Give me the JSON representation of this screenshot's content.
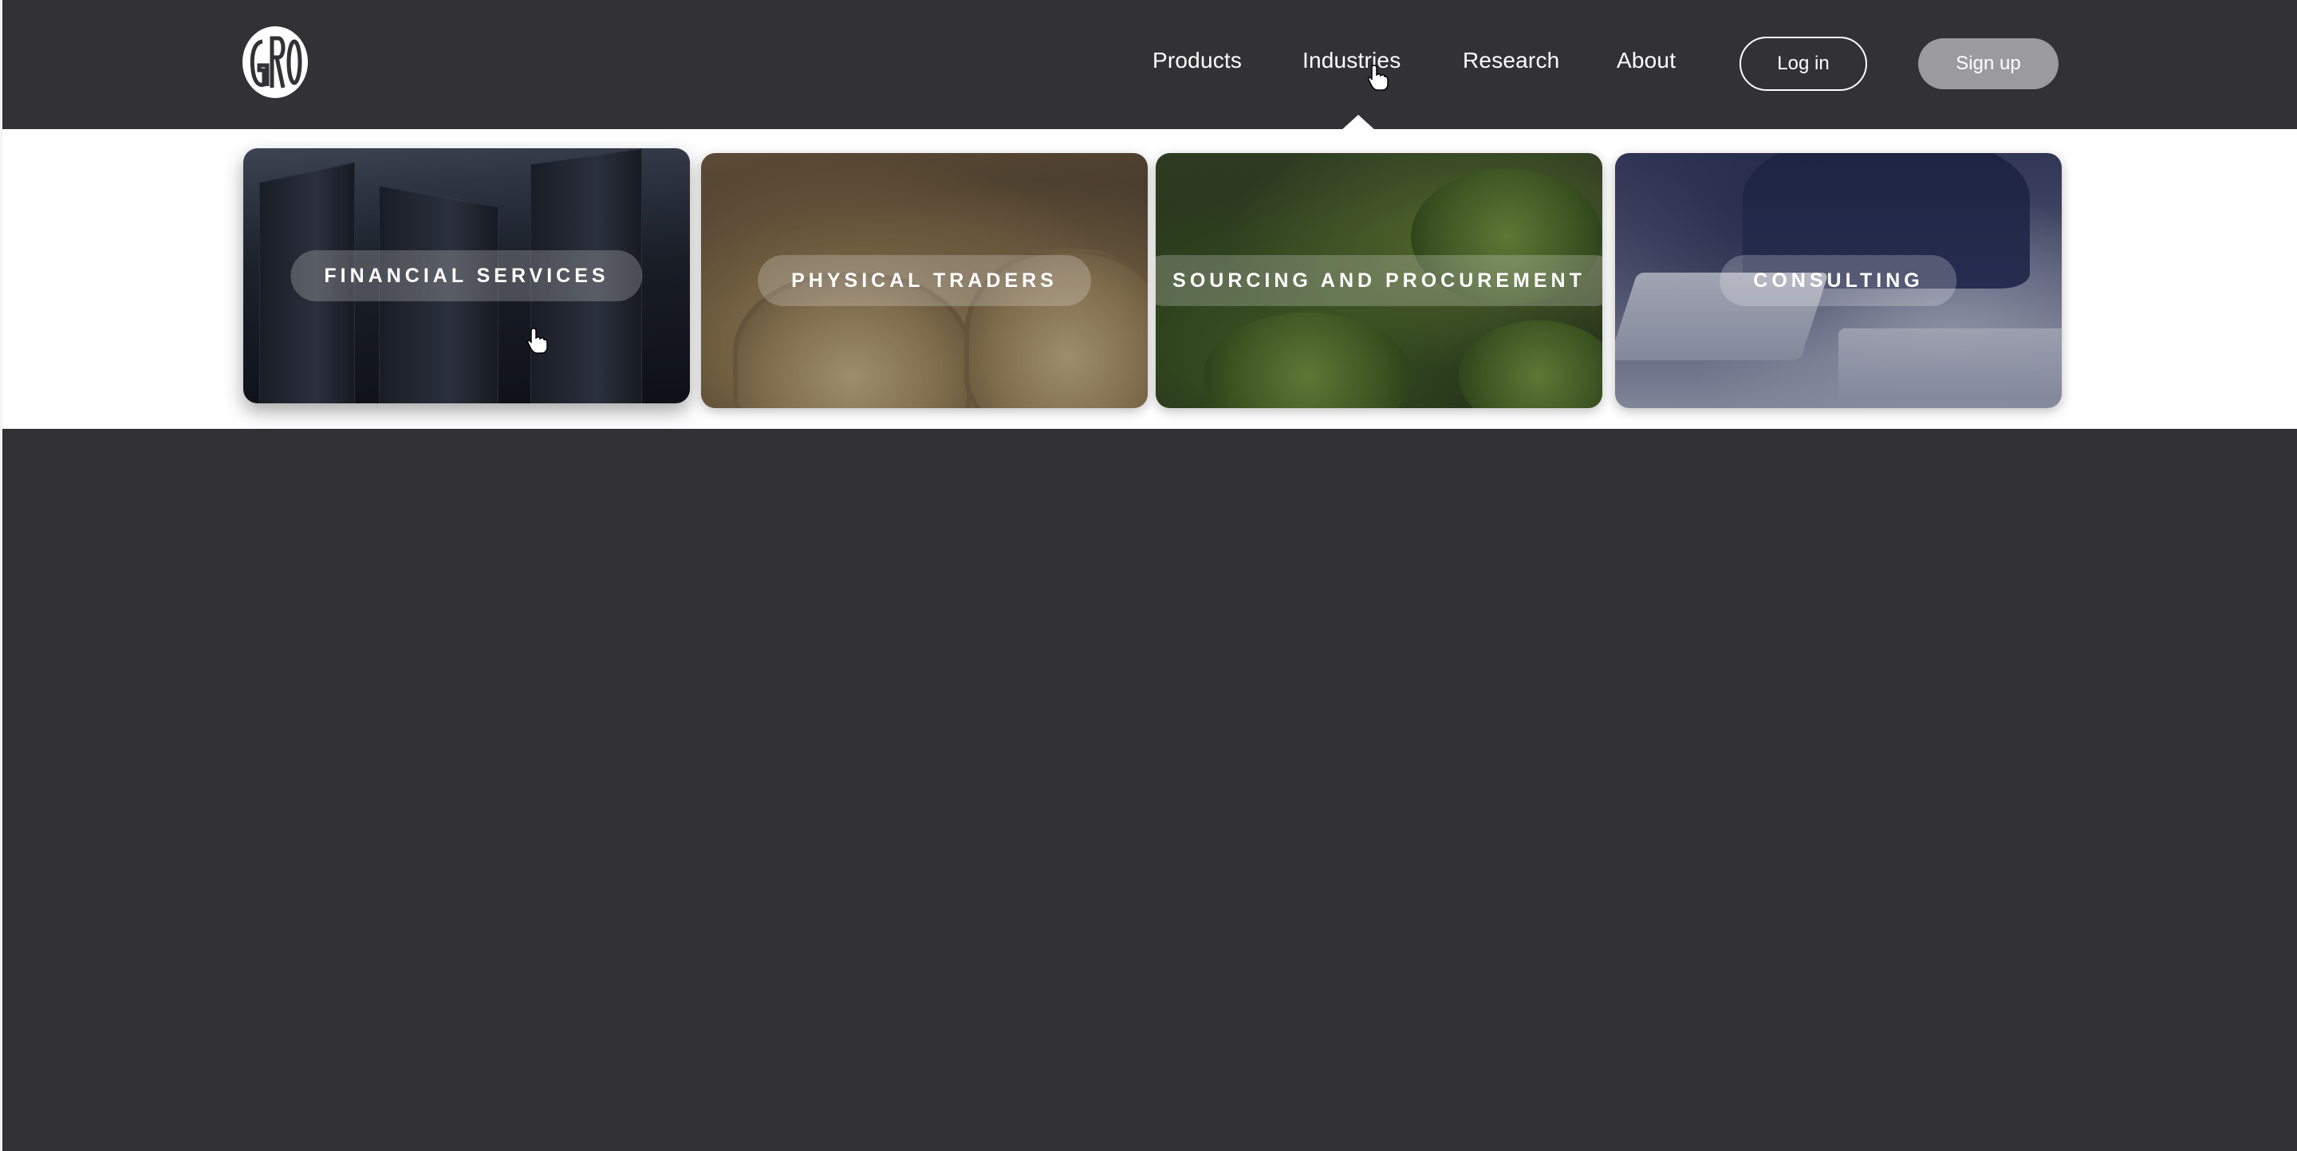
{
  "header": {
    "logo_alt": "GRO",
    "nav": {
      "products": "Products",
      "industries": "Industries",
      "research": "Research",
      "about": "About"
    },
    "login_label": "Log in",
    "signup_label": "Sign up"
  },
  "industries_menu": {
    "cards": [
      {
        "label": "FINANCIAL SERVICES",
        "image": "office-towers",
        "active": true
      },
      {
        "label": "PHYSICAL TRADERS",
        "image": "grain-sacks",
        "active": false
      },
      {
        "label": "SOURCING AND PROCUREMENT",
        "image": "vegetables-market",
        "active": false
      },
      {
        "label": "CONSULTING",
        "image": "business-meeting",
        "active": false
      }
    ]
  },
  "hero": {
    "partial_heading": "",
    "background_color": "#323234"
  },
  "colors": {
    "header_bg": "#323234",
    "dropdown_bg": "#ffffff",
    "signup_bg": "#9b9b9d",
    "text": "#ffffff"
  },
  "icons": {
    "logo": "gro-logo",
    "pointer": "hand-pointer-icon"
  }
}
